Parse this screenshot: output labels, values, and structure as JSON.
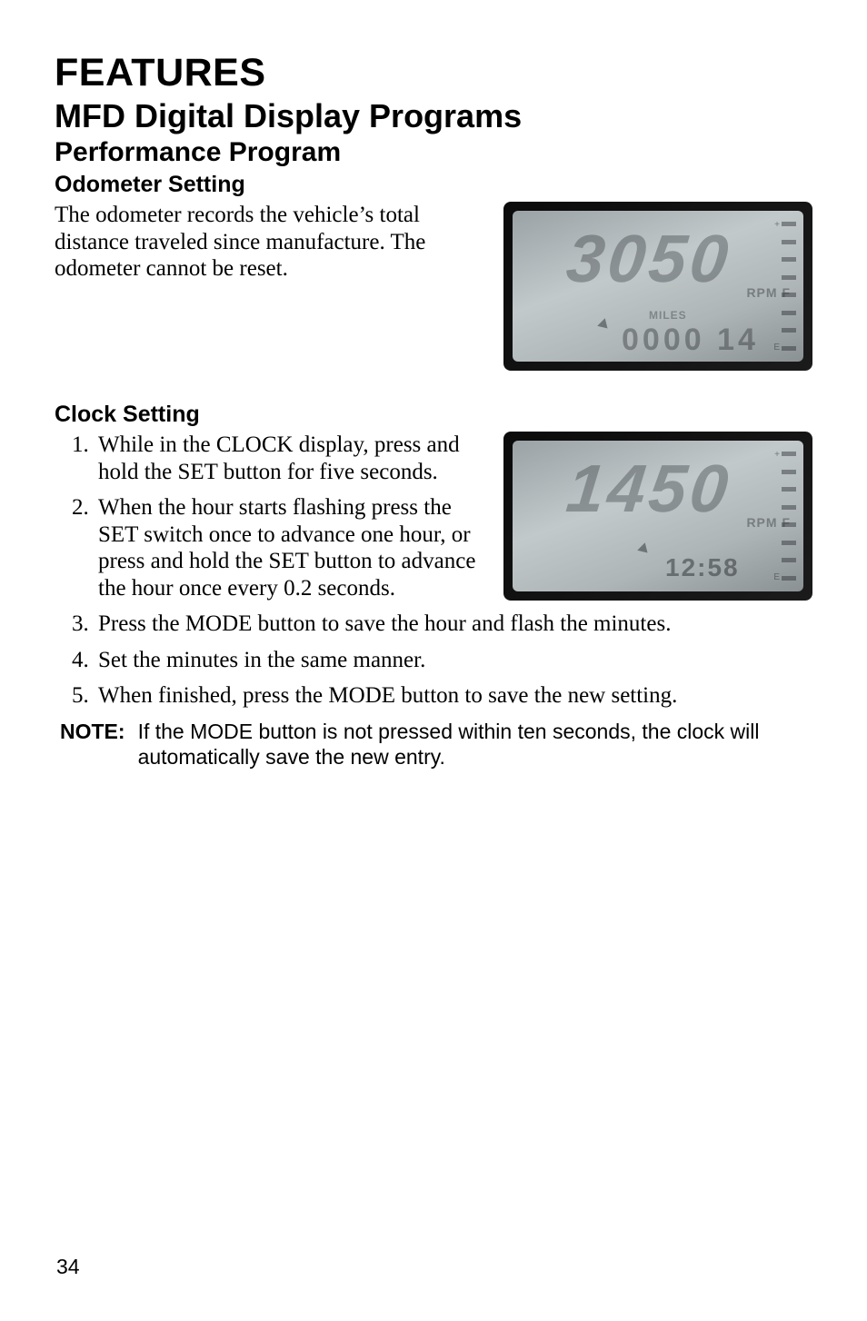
{
  "headings": {
    "features": "FEATURES",
    "mfd": "MFD Digital Display Programs",
    "perf": "Performance Program",
    "odometer": "Odometer Setting",
    "clock": "Clock Setting"
  },
  "odometer_para": "The odometer records the vehicle’s total distance traveled since manufacture.  The odometer cannot be reset.",
  "clock_steps": [
    "While in the CLOCK display, press and hold the SET button for five seconds.",
    "When the hour starts flashing press the SET switch once to advance one hour, or press and hold the SET button to advance the hour once every 0.2 seconds.",
    "Press the MODE button to save the hour and flash the minutes.",
    "Set the minutes in the same manner.",
    "When finished, press the MODE button to save the new setting."
  ],
  "note": {
    "label": "NOTE:",
    "body": "If the MODE button is not pressed within ten seconds, the clock will automatically save the new entry."
  },
  "page_number": "34",
  "lcd_odometer": {
    "big": "3050",
    "rpm": "RPM F",
    "miles": "MILES",
    "small": "0000 14",
    "fuel_top": "+",
    "fuel_bottom": "E",
    "fuel_full_label": "F"
  },
  "lcd_clock": {
    "big": "1450",
    "rpm": "RPM F",
    "time": "12:58",
    "fuel_top": "+",
    "fuel_bottom": "E",
    "fuel_full_label": "F"
  }
}
